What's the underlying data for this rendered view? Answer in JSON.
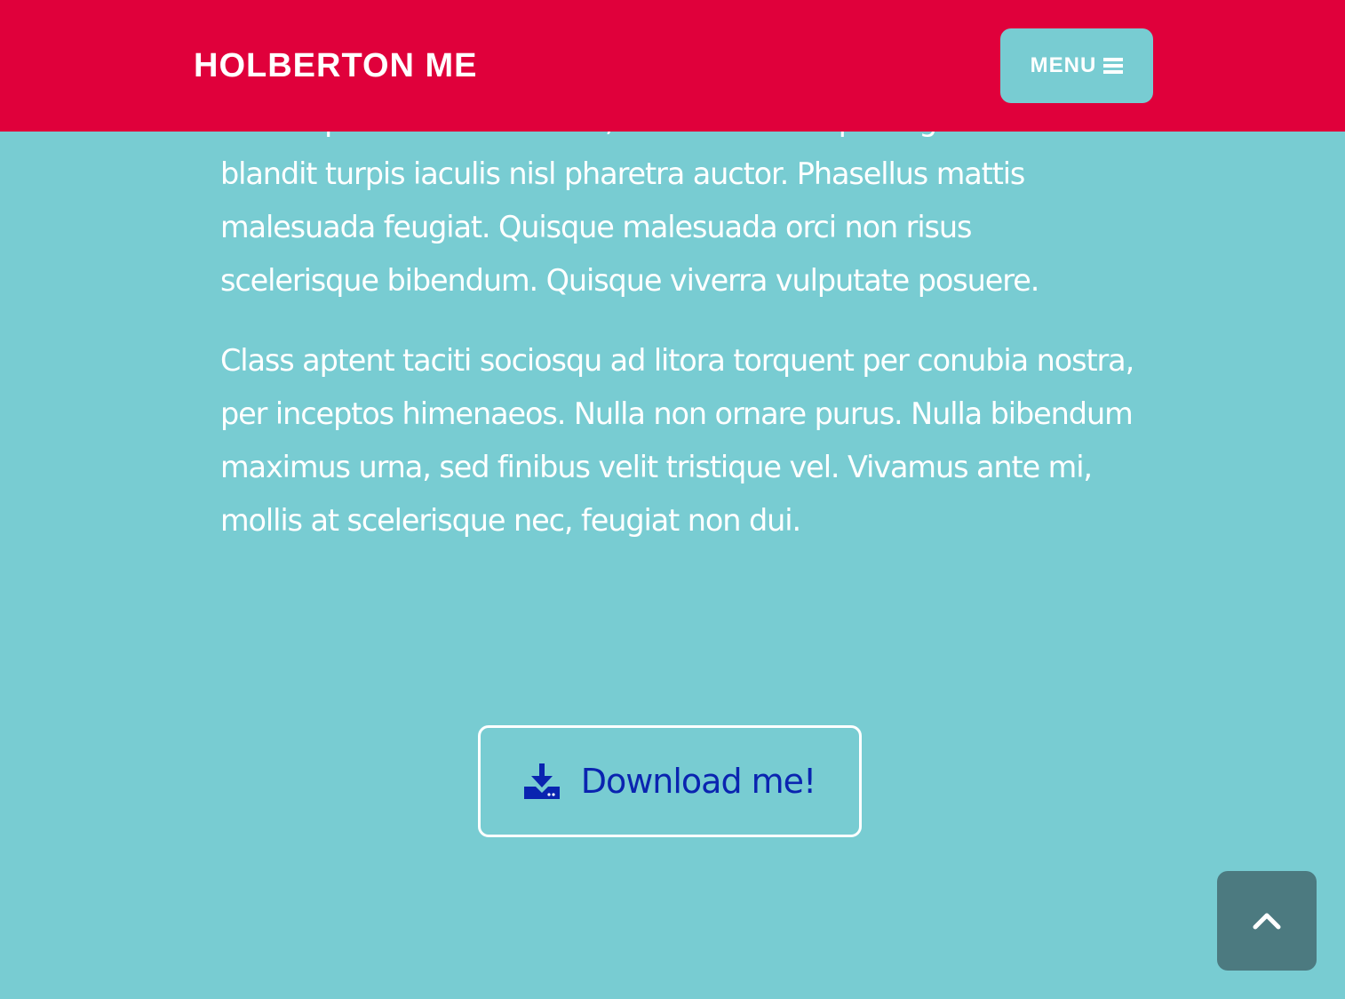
{
  "navbar": {
    "brand": "HOLBERTON ME",
    "menu_label": "MENU",
    "menu_icon": "bars-icon"
  },
  "content": {
    "paragraph_1": "Lorem ipsum dolor sit amet, consectetur adipiscing elit. Nam blandit turpis iaculis nisl pharetra auctor. Phasellus mattis malesuada feugiat. Quisque malesuada orci non risus scelerisque bibendum. Quisque viverra vulputate posuere.",
    "paragraph_2": "Class aptent taciti sociosqu ad litora torquent per conubia nostra, per inceptos himenaeos. Nulla non ornare purus. Nulla bibendum maximus urna, sed finibus velit tristique vel. Vivamus ante mi, mollis at scelerisque nec, feugiat non dui."
  },
  "download": {
    "label": "Download me!",
    "icon": "download-icon"
  },
  "back_to_top": {
    "icon": "chevron-up-icon"
  },
  "colors": {
    "navbar_bg": "#E0003B",
    "page_bg": "#78CCD2",
    "menu_bg": "#78CCD2",
    "download_text": "#0A24B0",
    "top_button_bg": "#4C7A80"
  }
}
